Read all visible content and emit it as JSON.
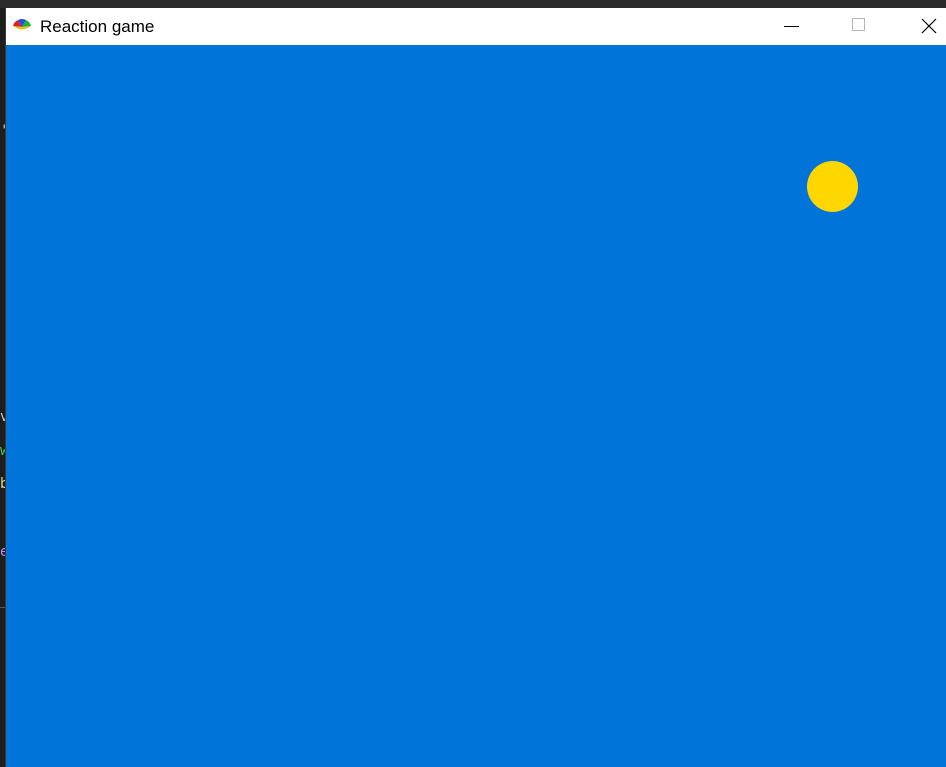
{
  "window": {
    "title": "Reaction game",
    "icon": "rgb-fan-app-icon",
    "controls": {
      "minimize_icon": "minimize-icon",
      "maximize_icon": "maximize-icon",
      "close_icon": "close-icon"
    }
  },
  "game": {
    "background_color": "#0074d9",
    "target": {
      "shape": "circle",
      "color": "#ffd700"
    }
  },
  "background": {
    "editor_color": "#1e1e1e",
    "edge_glyphs": [
      {
        "text": "'",
        "color": "#cccccc"
      },
      {
        "text": "v",
        "color": "#cccccc"
      },
      {
        "text": "w",
        "color": "#4ec94e"
      },
      {
        "text": "b",
        "color": "#e0d890"
      },
      {
        "text": "e",
        "color": "#b58cf0"
      }
    ]
  }
}
